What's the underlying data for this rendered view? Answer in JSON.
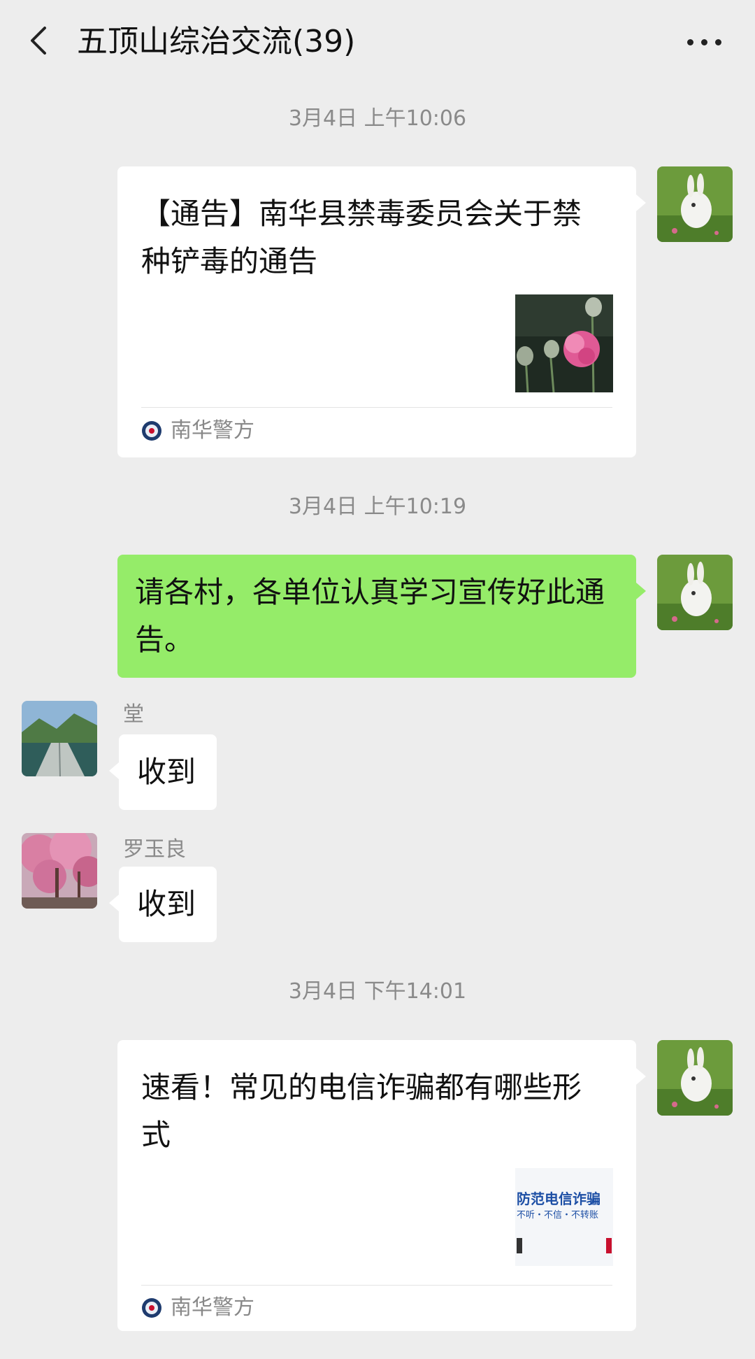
{
  "header": {
    "title": "五顶山综治交流(39)"
  },
  "messages": {
    "ts1": "3月4日 上午10:06",
    "card1": {
      "title": "【通告】南华县禁毒委员会关于禁种铲毒的通告",
      "source": "南华警方"
    },
    "ts2": "3月4日 上午10:19",
    "text1": "请各村，各单位认真学习宣传好此通告。",
    "reply1": {
      "name": "堂",
      "text": "收到"
    },
    "reply2": {
      "name": "罗玉良",
      "text": "收到"
    },
    "ts3": "3月4日 下午14:01",
    "card2": {
      "title": "速看！常见的电信诈骗都有哪些形式",
      "source": "南华警方",
      "thumb_line1": "防范电信诈骗",
      "thumb_line2": "不听・不信・不转账"
    }
  },
  "colors": {
    "background": "#ededed",
    "outgoing_bubble": "#95ec69",
    "incoming_bubble": "#ffffff",
    "timestamp": "#8a8a8a"
  },
  "icons": [
    "back-arrow-icon",
    "more-dots-icon",
    "police-badge-icon"
  ]
}
